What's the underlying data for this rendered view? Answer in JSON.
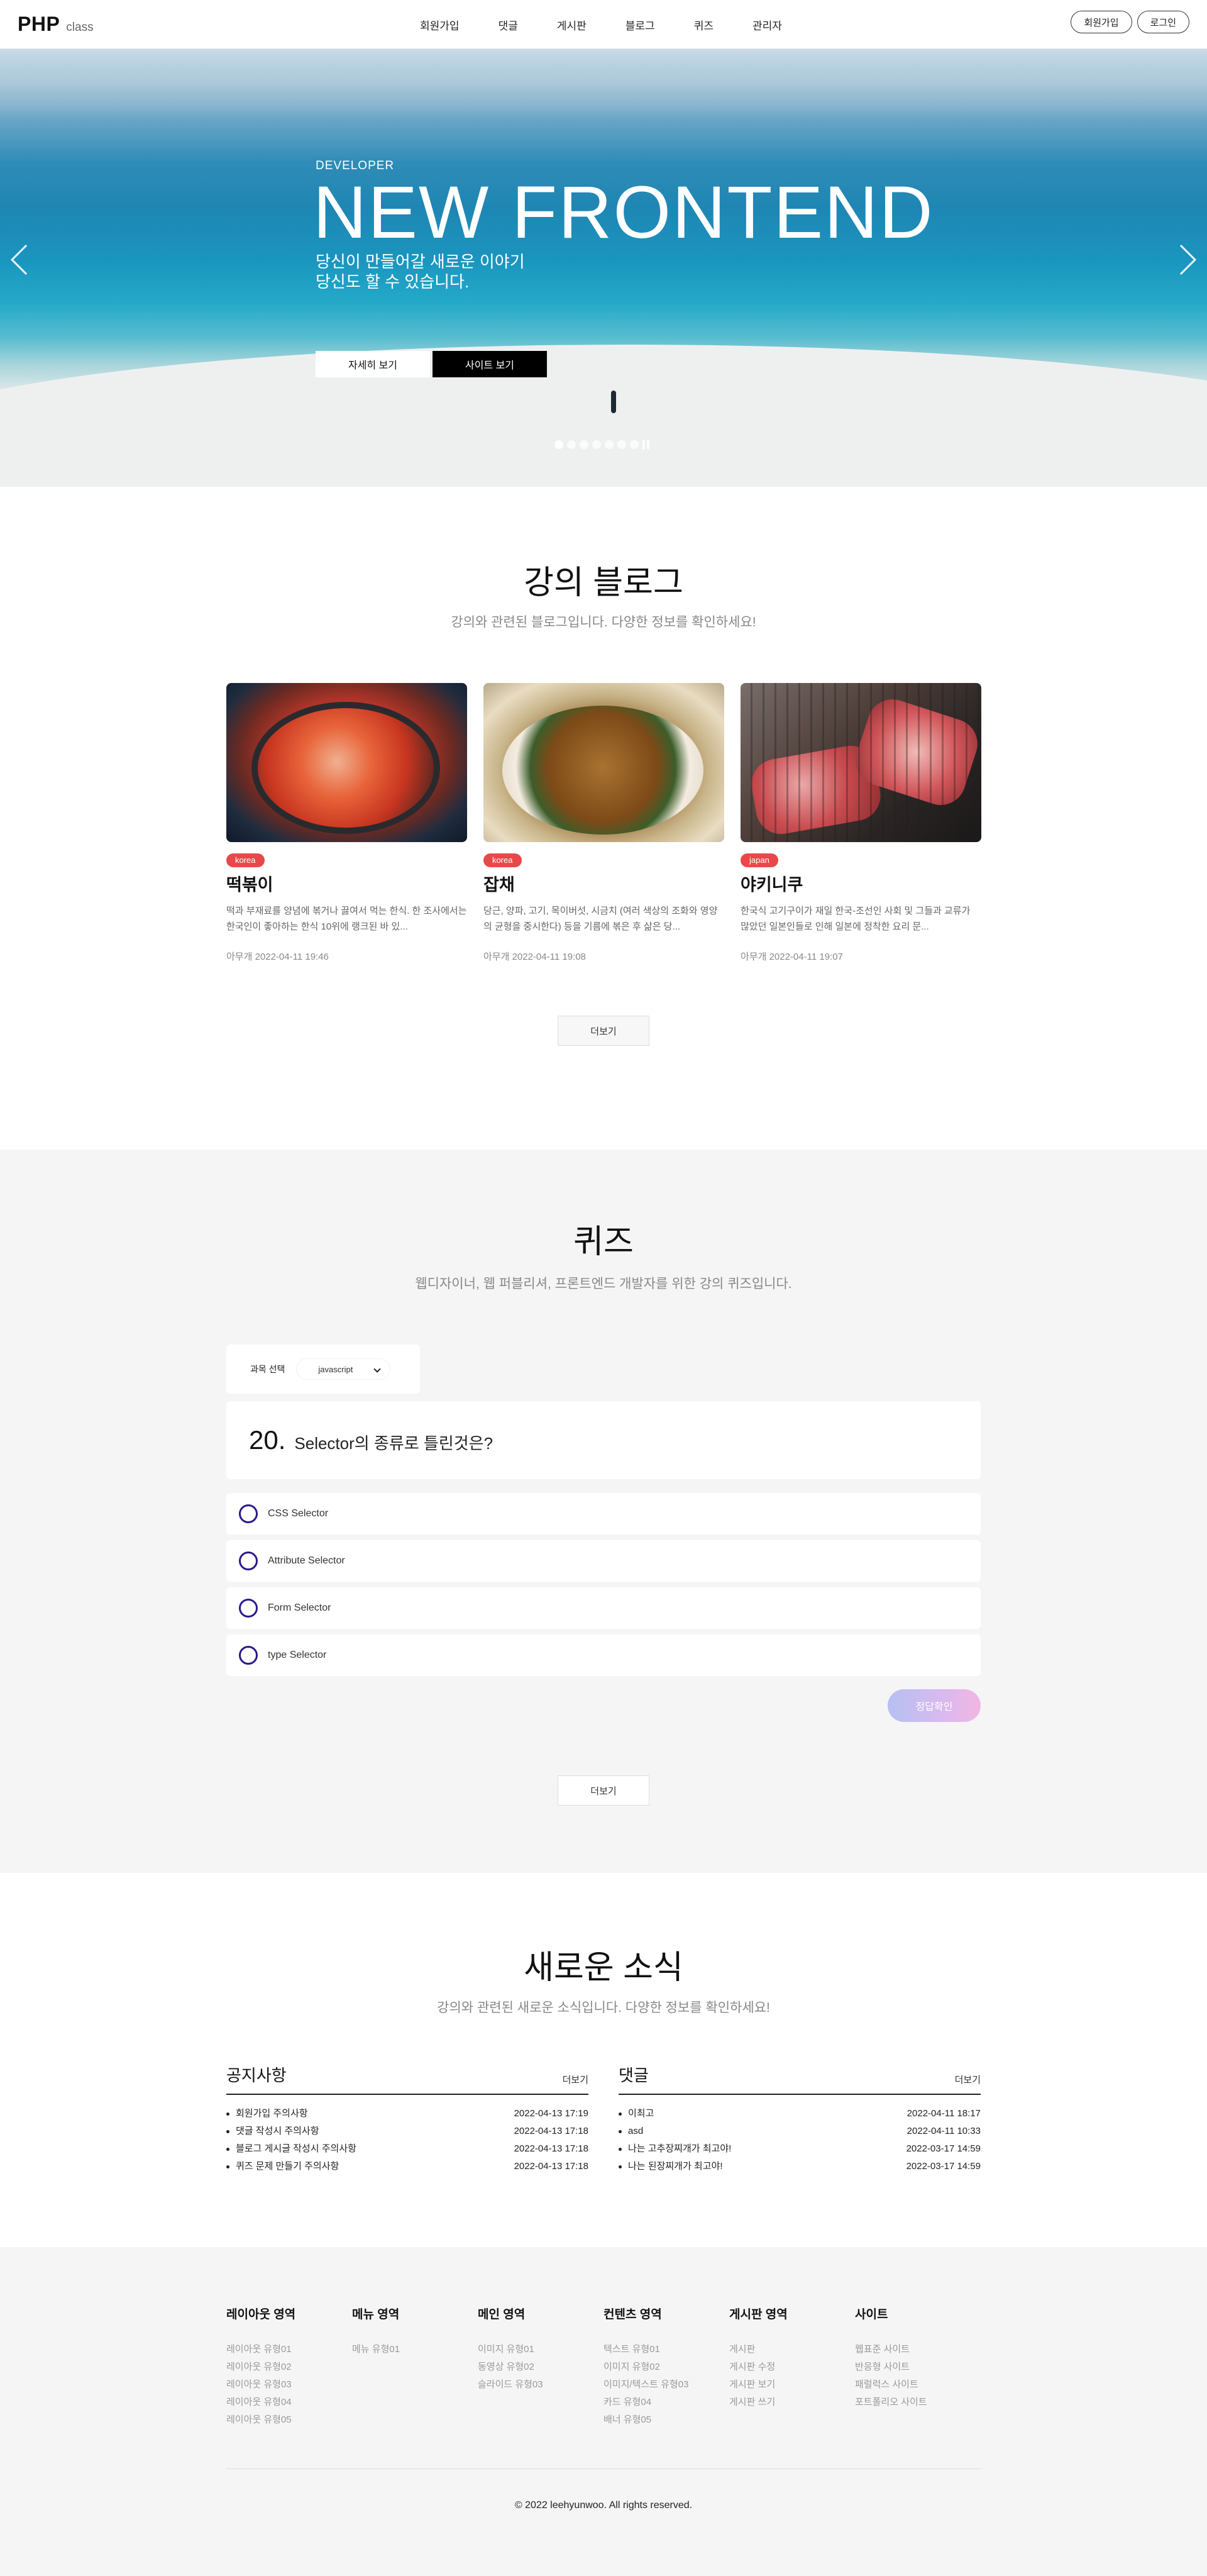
{
  "header": {
    "logo_main": "PHP",
    "logo_sub": "class",
    "nav": [
      "회원가입",
      "댓글",
      "게시판",
      "블로그",
      "퀴즈",
      "관리자"
    ],
    "signup": "회원가입",
    "login": "로그인"
  },
  "hero": {
    "eyebrow": "DEVELOPER",
    "title": "NEW FRONTEND",
    "desc_line1": "당신이 만들어갈 새로운 이야기",
    "desc_line2": "당신도 할 수 있습니다.",
    "btn_detail": "자세히 보기",
    "btn_site": "사이트 보기",
    "slide_count": 7,
    "active_slide": 1
  },
  "blog": {
    "title": "강의 블로그",
    "subtitle": "강의와 관련된 블로그입니다. 다양한 정보를 확인하세요!",
    "cards": [
      {
        "tag": "korea",
        "title": "떡볶이",
        "text": "떡과 부재료를 양념에 볶거나 끓여서 먹는 한식. 한 조사에서는 한국인이 좋아하는 한식 10위에 랭크된 바 있...",
        "meta": "아무개 2022-04-11 19:46"
      },
      {
        "tag": "korea",
        "title": "잡채",
        "text": "당근, 양파, 고기, 목이버섯, 시금치 (여러 색상의 조화와 영양의 균형을 중시한다) 등을 기름에 볶은 후 삶은 당...",
        "meta": "아무개 2022-04-11 19:08"
      },
      {
        "tag": "japan",
        "title": "야키니쿠",
        "text": "한국식 고기구이가 재일 한국-조선인 사회 및 그들과 교류가 많았던 일본인들로 인해 일본에 정착한 요리 문...",
        "meta": "아무개 2022-04-11 19:07"
      }
    ],
    "more": "더보기"
  },
  "quiz": {
    "title": "퀴즈",
    "subtitle": "웹디자이너, 웹 퍼블리셔, 프론트엔드 개발자를 위한 강의 퀴즈입니다.",
    "select_label": "과목 선택",
    "select_value": "javascript",
    "question_number": "20.",
    "question_text": "Selector의 종류로 틀린것은?",
    "options": [
      "CSS Selector",
      "Attribute Selector",
      "Form Selector",
      "type Selector"
    ],
    "answer_btn": "정답확인",
    "more": "더보기"
  },
  "news": {
    "title": "새로운 소식",
    "subtitle": "강의와 관련된 새로운 소식입니다. 다양한 정보를 확인하세요!",
    "notice": {
      "title": "공지사항",
      "more": "더보기",
      "items": [
        {
          "text": "회원가입 주의사항",
          "date": "2022-04-13 17:19"
        },
        {
          "text": "댓글 작성시 주의사항",
          "date": "2022-04-13 17:18"
        },
        {
          "text": "블로그 게시글 작성시 주의사항",
          "date": "2022-04-13 17:18"
        },
        {
          "text": "퀴즈 문제 만들기 주의사항",
          "date": "2022-04-13 17:18"
        }
      ]
    },
    "comments": {
      "title": "댓글",
      "more": "더보기",
      "items": [
        {
          "text": "이최고",
          "date": "2022-04-11 18:17"
        },
        {
          "text": "asd",
          "date": "2022-04-11 10:33"
        },
        {
          "text": "나는 고추장찌개가 최고야!",
          "date": "2022-03-17 14:59"
        },
        {
          "text": "나는 된장찌개가 최고야!",
          "date": "2022-03-17 14:59"
        }
      ]
    }
  },
  "footer": {
    "columns": [
      {
        "title": "레이아웃 영역",
        "links": [
          "레이아웃 유형01",
          "레이아웃 유형02",
          "레이아웃 유형03",
          "레이아웃 유형04",
          "레이아웃 유형05"
        ]
      },
      {
        "title": "메뉴 영역",
        "links": [
          "메뉴 유형01"
        ]
      },
      {
        "title": "메인 영역",
        "links": [
          "이미지 유형01",
          "동영상 유형02",
          "슬라이드 유형03"
        ]
      },
      {
        "title": "컨텐츠 영역",
        "links": [
          "텍스트 유형01",
          "이미지 유형02",
          "이미지/텍스트 유형03",
          "카드 유형04",
          "배너 유형05"
        ]
      },
      {
        "title": "게시판 영역",
        "links": [
          "게시판",
          "게시판 수정",
          "게시판 보기",
          "게시판 쓰기"
        ]
      },
      {
        "title": "사이트",
        "links": [
          "웹표준 사이트",
          "반응형 사이트",
          "패럴럭스 사이트",
          "포트폴리오 사이트"
        ]
      }
    ],
    "copyright": "© 2022 leehyunwoo. All rights reserved."
  }
}
